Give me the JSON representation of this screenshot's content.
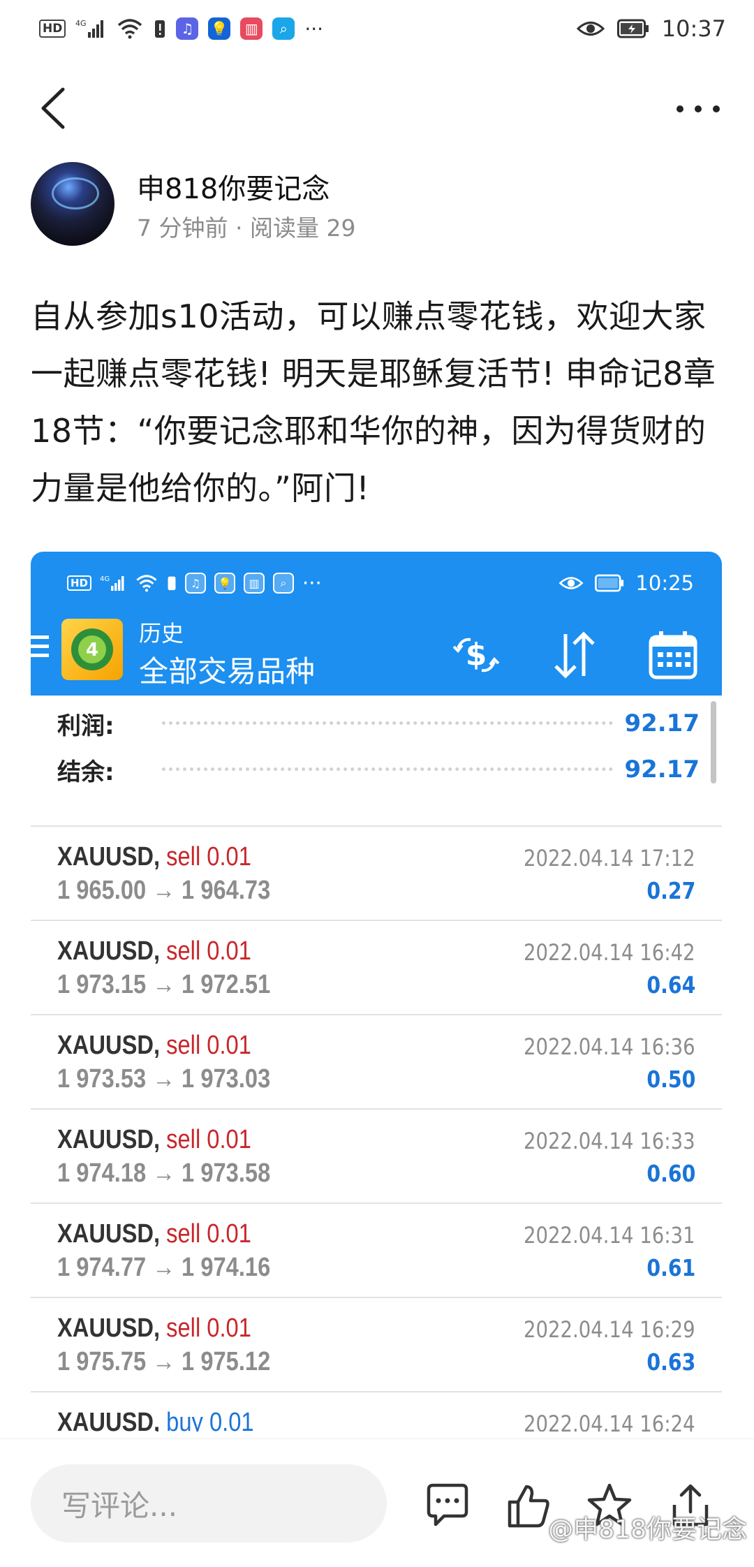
{
  "status_bar": {
    "hd": "HD",
    "network": "4G",
    "more": "···",
    "time": "10:37"
  },
  "author": {
    "name": "申818你要记念",
    "meta": "7 分钟前 · 阅读量 29"
  },
  "post": {
    "text": "自从参加s10活动，可以赚点零花钱，欢迎大家一起赚点零花钱! 明天是耶稣复活节! 申命记8章18节：“你要记念耶和华你的神，因为得货财的力量是他给你的。”阿门!"
  },
  "screenshot": {
    "status_time": "10:25",
    "status_hd": "HD",
    "status_network": "4G",
    "status_more": "···",
    "header_title": "历史",
    "header_subtitle": "全部交易品种",
    "summary": [
      {
        "label": "利润:",
        "value": "92.17"
      },
      {
        "label": "结余:",
        "value": "92.17"
      }
    ],
    "trades": [
      {
        "symbol": "XAUUSD",
        "type": "sell",
        "lots": "0.01",
        "open": "1 965.00",
        "close": "1 964.73",
        "date": "2022.04.14 17:12",
        "profit": "0.27"
      },
      {
        "symbol": "XAUUSD",
        "type": "sell",
        "lots": "0.01",
        "open": "1 973.15",
        "close": "1 972.51",
        "date": "2022.04.14 16:42",
        "profit": "0.64"
      },
      {
        "symbol": "XAUUSD",
        "type": "sell",
        "lots": "0.01",
        "open": "1 973.53",
        "close": "1 973.03",
        "date": "2022.04.14 16:36",
        "profit": "0.50"
      },
      {
        "symbol": "XAUUSD",
        "type": "sell",
        "lots": "0.01",
        "open": "1 974.18",
        "close": "1 973.58",
        "date": "2022.04.14 16:33",
        "profit": "0.60"
      },
      {
        "symbol": "XAUUSD",
        "type": "sell",
        "lots": "0.01",
        "open": "1 974.77",
        "close": "1 974.16",
        "date": "2022.04.14 16:31",
        "profit": "0.61"
      },
      {
        "symbol": "XAUUSD",
        "type": "sell",
        "lots": "0.01",
        "open": "1 975.75",
        "close": "1 975.12",
        "date": "2022.04.14 16:29",
        "profit": "0.63"
      },
      {
        "symbol": "XAUUSD",
        "type": "buy",
        "lots": "0.01",
        "open": "",
        "close": "",
        "date": "2022.04.14 16:24",
        "profit": ""
      }
    ]
  },
  "bottom_bar": {
    "comment_placeholder": "写评论...",
    "watermark": "@申818你要记念"
  },
  "colors": {
    "header_blue": "#1c8ff0",
    "sell_red": "#c8262a",
    "buy_blue": "#1a74d8",
    "profit_blue": "#1a74d8"
  }
}
